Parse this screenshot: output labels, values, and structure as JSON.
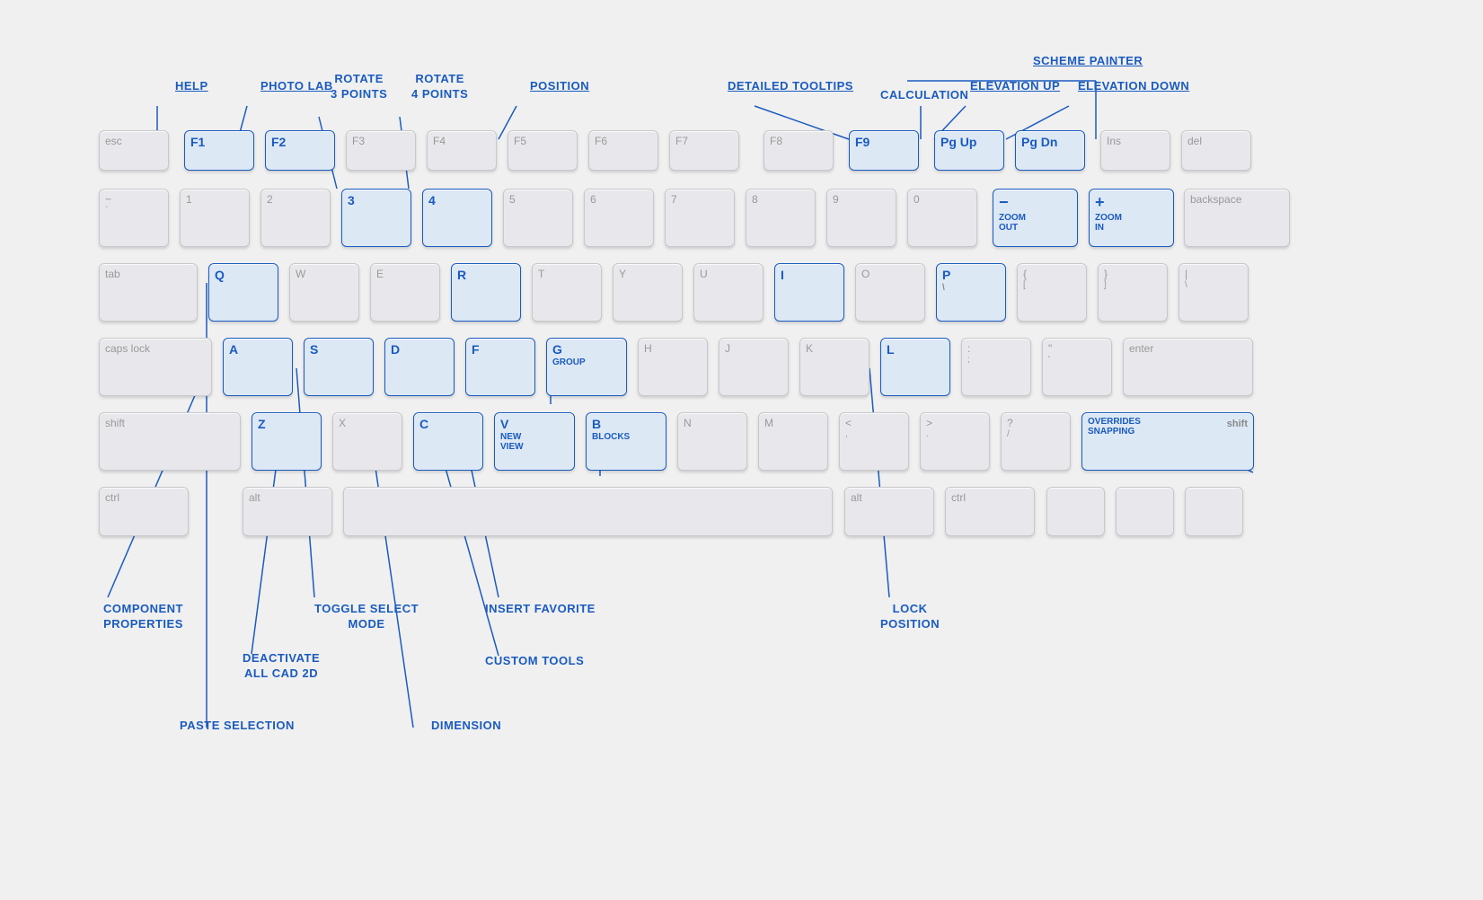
{
  "annotations": {
    "help": "HELP",
    "photo_lab": "PHOTO LAB",
    "rotate_3": "ROTATE\n3 POINTS",
    "rotate_4": "ROTATE\n4 POINTS",
    "position": "POSITION",
    "detailed_tooltips": "DETAILED TOOLTIPS",
    "scheme_painter": "SCHEME PAINTER",
    "calculation": "CALCULATION",
    "elevation_up": "ELEVATION UP",
    "elevation_down": "ELEVATION DOWN",
    "zoom_out": "ZOOM\nOUT",
    "zoom_in": "ZOOM\nIN",
    "group": "GROUP",
    "new_view": "NEW\nVIEW",
    "blocks": "BLOCKS",
    "overrides_snapping": "OVERRIDES\nSNAPPING",
    "component_properties": "COMPONENT\nPROPERTIES",
    "paste_selection": "PASTE  SELECTION",
    "deactivate_all_cad": "DEACTIVATE\nALL CAD 2D",
    "toggle_select": "TOGGLE  SELECT\nMODE",
    "dimension": "DIMENSION",
    "insert_favorite": "INSERT  FAVORITE",
    "custom_tools": "CUSTOM TOOLS",
    "lock_position": "LOCK\nPOSITION"
  },
  "keys": {
    "esc": "esc",
    "f1": "F1",
    "f2": "F2",
    "f3": "F3",
    "f4": "F4",
    "f5": "F5",
    "f6": "F6",
    "f7": "F7",
    "f8": "F8",
    "f9": "F9",
    "pgup": "Pg Up",
    "pgdn": "Pg Dn",
    "ins": "Ins",
    "del": "del"
  }
}
